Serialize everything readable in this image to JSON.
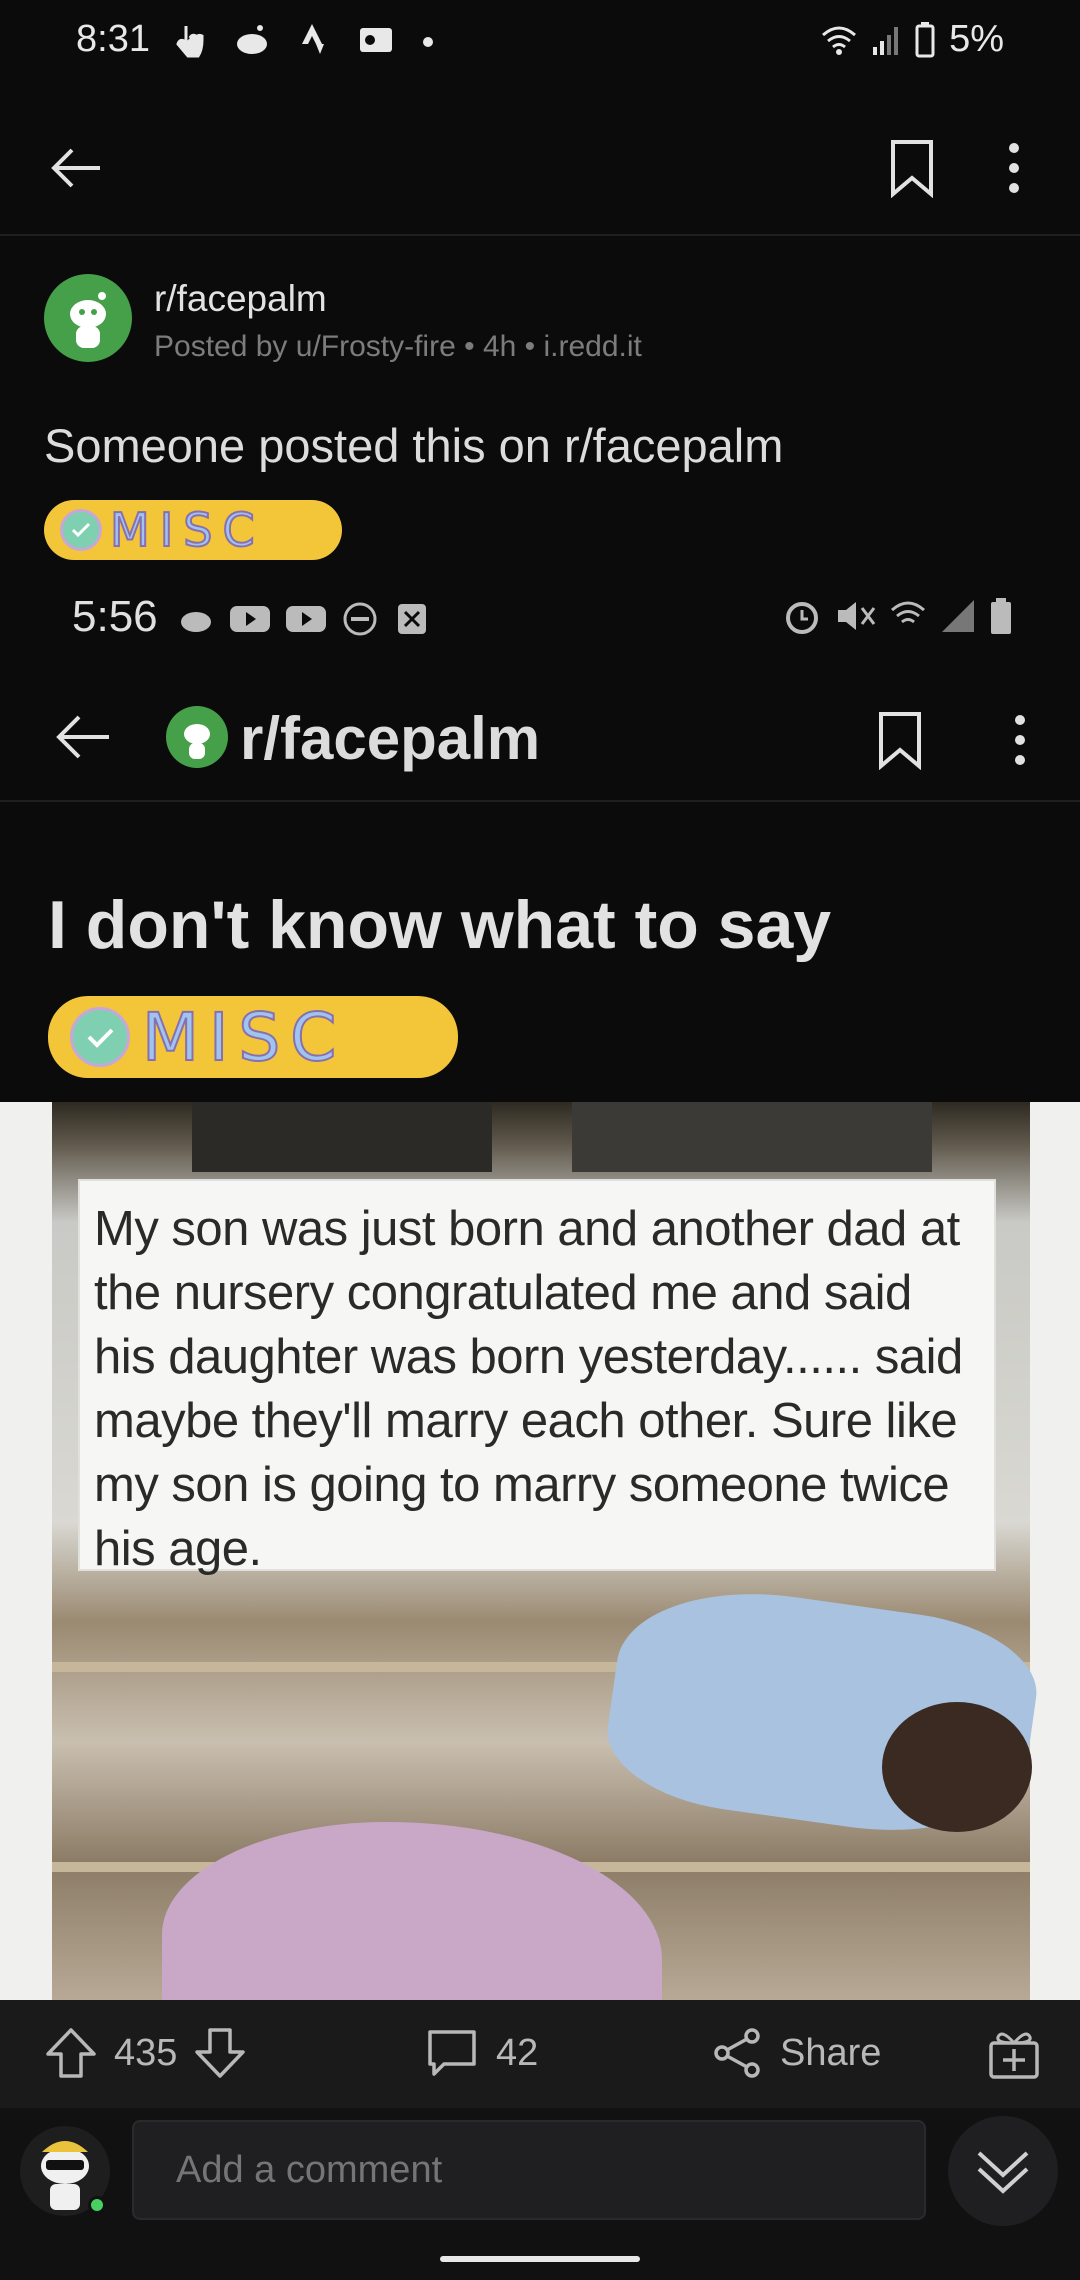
{
  "status_bar": {
    "time": "8:31",
    "battery": "5%"
  },
  "post": {
    "subreddit": "r/facepalm",
    "meta": "Posted by u/Frosty-fire • 4h • i.redd.it",
    "title": "Someone posted this on r/facepalm",
    "flair": "MISC"
  },
  "embedded": {
    "time": "5:56",
    "subreddit": "r/facepalm",
    "title": "I don't know what to say",
    "flair": "MISC",
    "meme_text": "My son was just born and another dad at the nursery congratulated me and said his daughter was born yesterday...... said maybe they'll marry each other. Sure like my son is going to marry someone twice his age."
  },
  "actions": {
    "votes": "435",
    "comments": "42",
    "share": "Share"
  },
  "comment_box": {
    "placeholder": "Add a comment"
  },
  "icons": [
    "back-arrow-icon",
    "bookmark-icon",
    "more-vert-icon",
    "upvote-icon",
    "downvote-icon",
    "comment-icon",
    "share-icon",
    "award-icon",
    "collapse-icon"
  ]
}
